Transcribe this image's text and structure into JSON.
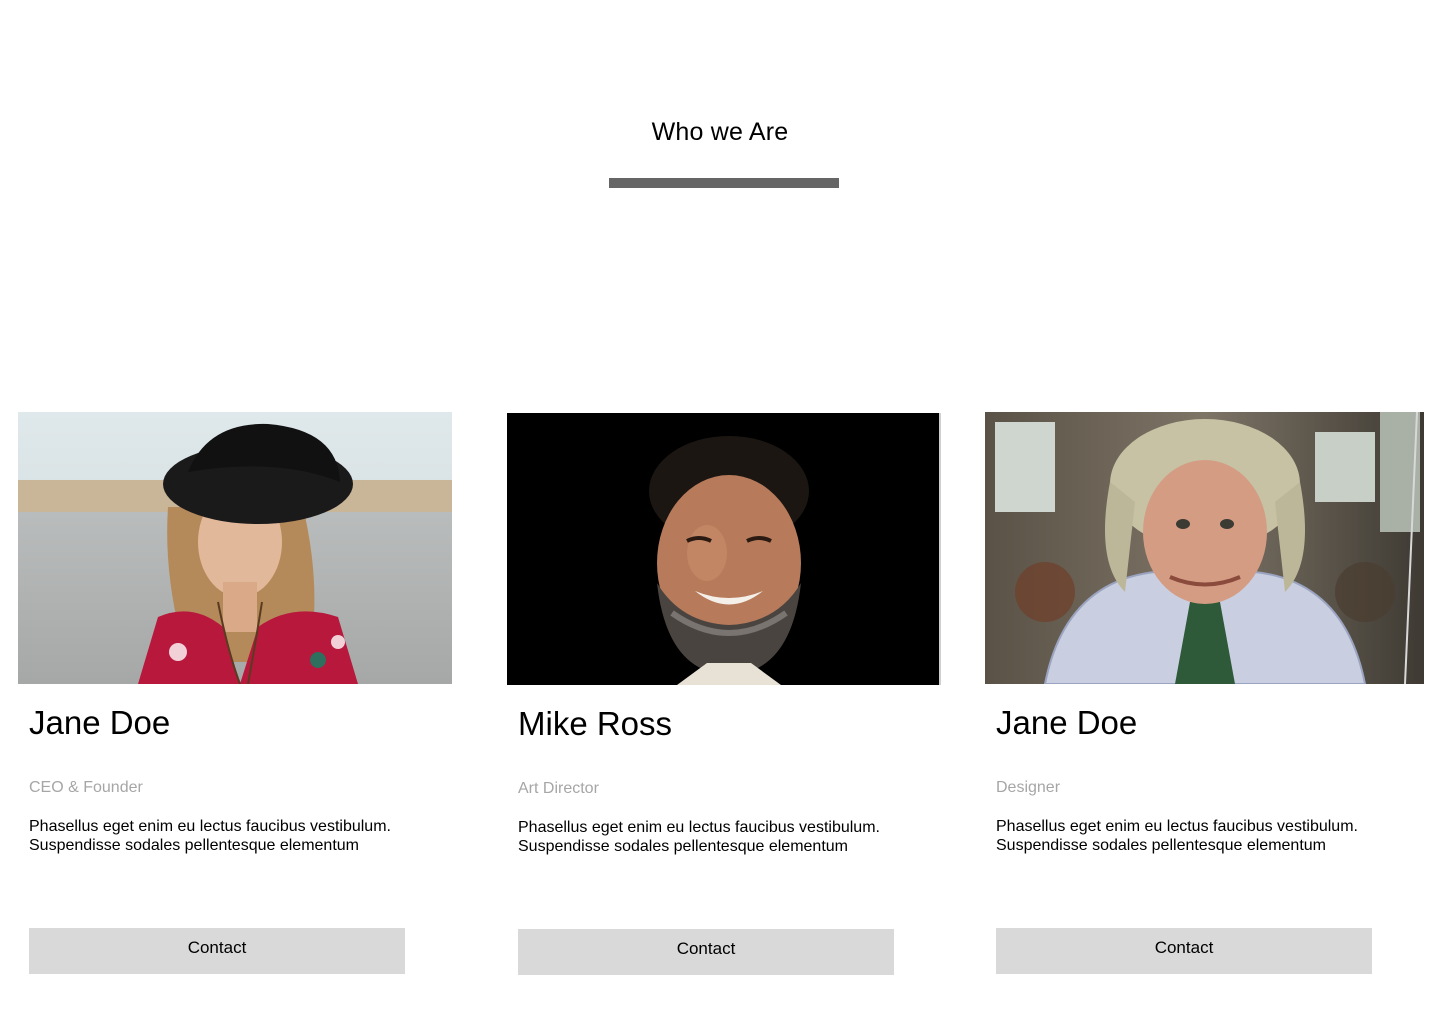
{
  "section": {
    "title": "Who we Are"
  },
  "team": [
    {
      "name": "Jane Doe",
      "role": "CEO & Founder",
      "bio": "Phasellus eget enim eu lectus faucibus vestibulum. Suspendisse sodales pellentesque elementum",
      "contact_label": "Contact"
    },
    {
      "name": "Mike Ross",
      "role": "Art Director",
      "bio": "Phasellus eget enim eu lectus faucibus vestibulum. Suspendisse sodales pellentesque elementum",
      "contact_label": "Contact"
    },
    {
      "name": "Jane Doe",
      "role": "Designer",
      "bio": "Phasellus eget enim eu lectus faucibus vestibulum. Suspendisse sodales pellentesque elementum",
      "contact_label": "Contact"
    }
  ],
  "colors": {
    "underline": "#666666",
    "button_bg": "#d9d9d9",
    "role_text": "#a6a6a6"
  }
}
